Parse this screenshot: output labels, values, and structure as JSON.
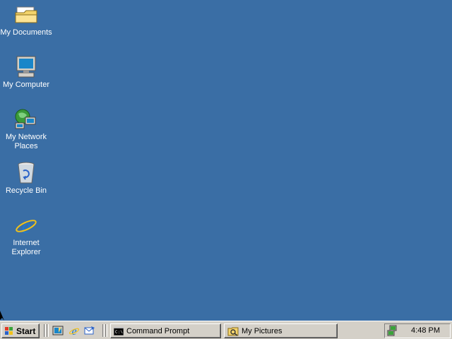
{
  "desktop": {
    "icons": [
      {
        "label": "My Documents",
        "icon": "my-documents-folder-icon"
      },
      {
        "label": "My Computer",
        "icon": "my-computer-icon"
      },
      {
        "label": "My Network Places",
        "icon": "network-places-icon"
      },
      {
        "label": "Recycle Bin",
        "icon": "recycle-bin-icon"
      },
      {
        "label": "Internet Explorer",
        "icon": "internet-explorer-icon"
      }
    ],
    "background_color": "#3a6ea5"
  },
  "taskbar": {
    "start_label": "Start",
    "quick_launch": [
      "show-desktop-icon",
      "internet-explorer-icon",
      "outlook-express-icon"
    ],
    "tasks": [
      {
        "label": "Command Prompt",
        "icon": "command-prompt-icon"
      },
      {
        "label": "My Pictures",
        "icon": "my-pictures-icon"
      }
    ],
    "tray": {
      "icon": "network-tray-icon",
      "clock": "4:48 PM"
    }
  }
}
